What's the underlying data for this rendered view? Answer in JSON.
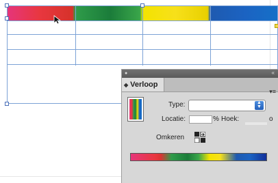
{
  "panel": {
    "tab_label": "Verloop",
    "type_label": "Type:",
    "type_value": "",
    "location_label": "Locatie:",
    "location_unit": "%",
    "angle_label": "Hoek:",
    "angle_unit": "o",
    "reverse_label": "Omkeren"
  },
  "icons": {
    "tab_toggle": "collapse-triangle-icon",
    "panel_menu": "panel-menu-icon",
    "select_arrows": "updown-arrows-icon",
    "reverse": "reverse-gradient-icon",
    "cursor": "arrow-cursor-icon"
  },
  "colors": {
    "selection": "#7ba2d6",
    "panel_bg": "#d7d7d7",
    "accent": "#2f6fd0"
  }
}
